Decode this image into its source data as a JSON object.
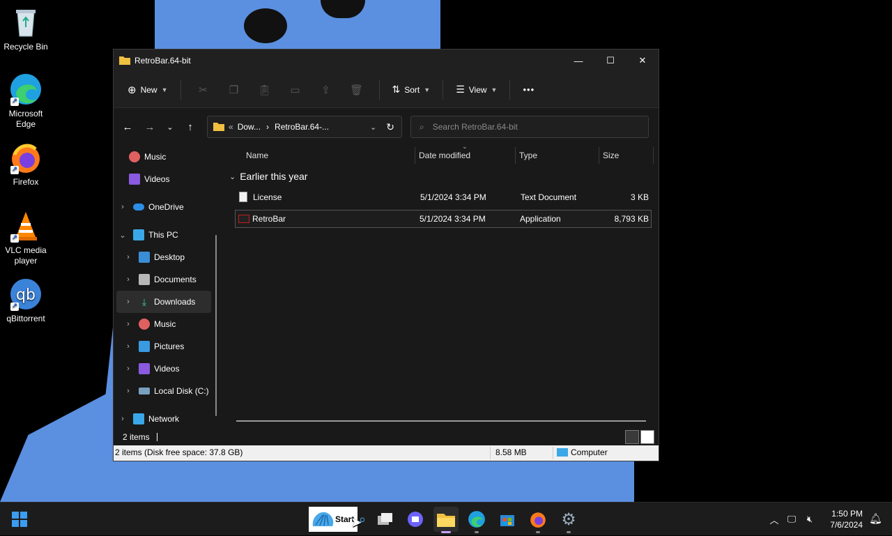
{
  "desktop": {
    "icons": [
      {
        "label": "Recycle Bin"
      },
      {
        "label": "Microsoft Edge"
      },
      {
        "label": "Firefox"
      },
      {
        "label": "VLC media player"
      },
      {
        "label": "qBittorrent"
      }
    ]
  },
  "window": {
    "title": "RetroBar.64-bit",
    "controls": {
      "minimize": "—",
      "maximize": "☐",
      "close": "✕"
    }
  },
  "toolbar": {
    "new_label": "New",
    "sort_label": "Sort",
    "view_label": "View",
    "more_label": "•••"
  },
  "address": {
    "path_part1": "Dow...",
    "path_sep": "›",
    "path_part2": "RetroBar.64-...",
    "search_placeholder": "Search RetroBar.64-bit"
  },
  "nav": {
    "items": [
      {
        "label": "Music"
      },
      {
        "label": "Videos"
      },
      {
        "label": "OneDrive"
      },
      {
        "label": "This PC"
      },
      {
        "label": "Desktop"
      },
      {
        "label": "Documents"
      },
      {
        "label": "Downloads"
      },
      {
        "label": "Music"
      },
      {
        "label": "Pictures"
      },
      {
        "label": "Videos"
      },
      {
        "label": "Local Disk (C:)"
      },
      {
        "label": "Network"
      }
    ]
  },
  "columns": {
    "name": "Name",
    "date": "Date modified",
    "type": "Type",
    "size": "Size"
  },
  "group_label": "Earlier this year",
  "files": [
    {
      "name": "License",
      "date": "5/1/2024 3:34 PM",
      "type": "Text Document",
      "size": "3 KB"
    },
    {
      "name": "RetroBar",
      "date": "5/1/2024 3:34 PM",
      "type": "Application",
      "size": "8,793 KB"
    }
  ],
  "status": {
    "item_count": "2 items",
    "bar_left": "2 items (Disk free space: 37.8 GB)",
    "bar_size": "8.58 MB",
    "bar_location": "Computer"
  },
  "taskbar": {
    "start_label": "Start",
    "time": "1:50 PM",
    "date": "7/6/2024"
  }
}
